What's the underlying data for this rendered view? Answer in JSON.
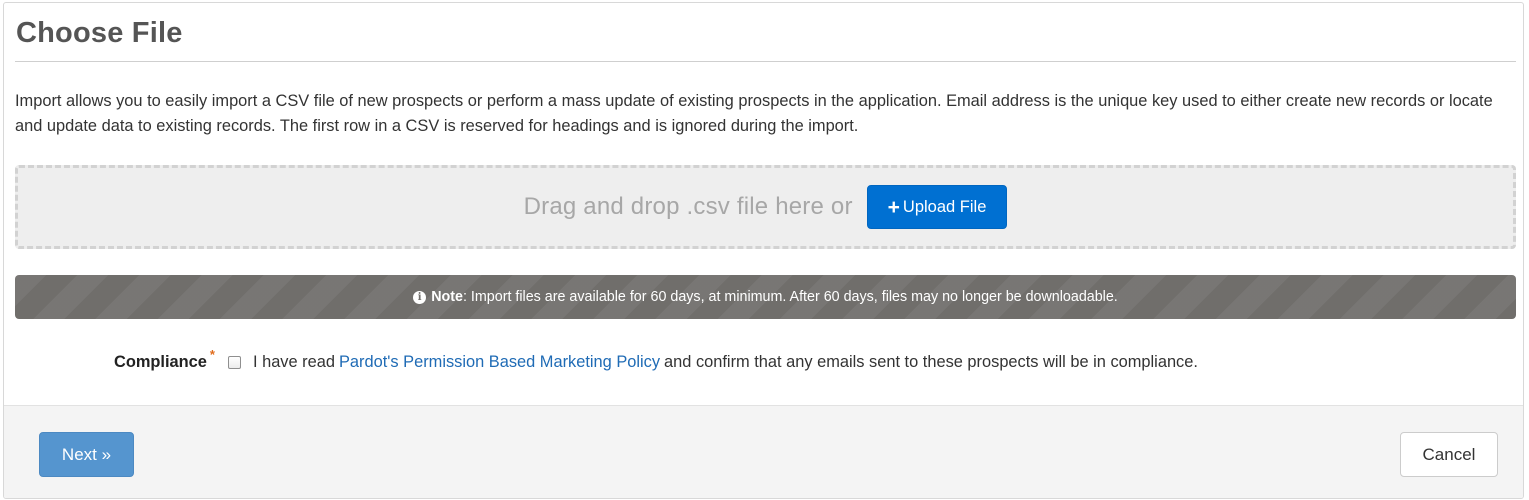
{
  "page": {
    "title": "Choose File",
    "intro": "Import allows you to easily import a CSV file of new prospects or perform a mass update of existing prospects in the application. Email address is the unique key used to either create new records or locate and update data to existing records. The first row in a CSV is reserved for headings and is ignored during the import."
  },
  "dropzone": {
    "text": "Drag and drop .csv file here or",
    "upload_icon": "plus-icon",
    "upload_label": "Upload File"
  },
  "note": {
    "icon": "info-circle-icon",
    "label": "Note",
    "text": ": Import files are available for 60 days, at minimum. After 60 days, files may no longer be downloadable."
  },
  "compliance": {
    "label": "Compliance",
    "required_marker": "*",
    "checked": false,
    "text_before": "I have read",
    "link_text": "Pardot's Permission Based Marketing Policy",
    "text_after": "and confirm that any emails sent to these prospects will be in compliance."
  },
  "footer": {
    "next_label": "Next »",
    "cancel_label": "Cancel"
  },
  "colors": {
    "primary_button": "#0070d2",
    "next_button": "#5595cf",
    "note_background": "#706e6b",
    "link": "#1f6bb5",
    "required_marker": "#e06c1d"
  }
}
